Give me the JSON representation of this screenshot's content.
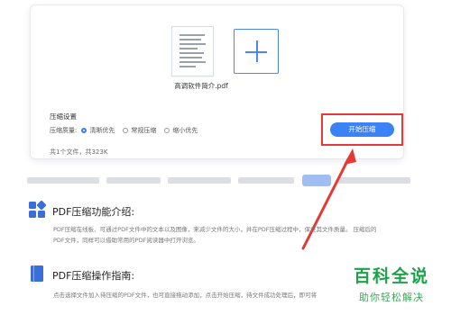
{
  "upload": {
    "file_name": "高调软件简介.pdf",
    "add_icon": "plus-icon"
  },
  "settings": {
    "title": "压缩设置",
    "quality_label": "压缩质量:",
    "options": [
      {
        "label": "清晰优先",
        "selected": true
      },
      {
        "label": "常规压缩",
        "selected": false
      },
      {
        "label": "缩小优先",
        "selected": false
      }
    ],
    "start_button": "开始压缩"
  },
  "summary": "共1个文件，共323K",
  "colors": {
    "accent": "#3b82f6",
    "highlight_border": "#e53935",
    "watermark": "#1fa14a"
  },
  "section1": {
    "icon": "apps-grid-icon",
    "title": "PDF压缩功能介绍:",
    "body_line1": "PDF压缩在线板、可通过PDF文件中的文本以及图像，来减少文件的大小，并在PDF压缩过程中，保证其文件质量。 压缩后的",
    "body_line2": "PDF文件，同样可以借助常用的PDF阅读器中打开浏览。"
  },
  "section2": {
    "icon": "book-icon",
    "title": "PDF压缩操作指南:",
    "body_line1": "点击选择文件加入待压缩的PDF文件，也可直接拖动添加，点击开始压缩，待文件成功处理后，即可将"
  },
  "watermark": {
    "title": "百科全说",
    "subtitle": "助你轻松解决"
  }
}
